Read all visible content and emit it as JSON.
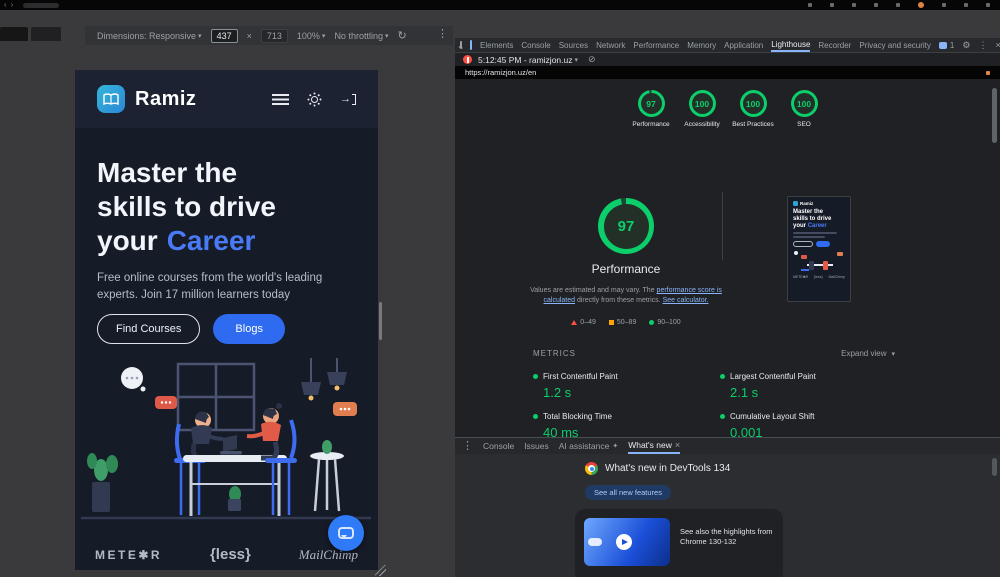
{
  "colors": {
    "accent_blue": "#8ab4f8",
    "green": "#0cce6b",
    "orange": "#ffa400",
    "red": "#ff4e42",
    "site_blue": "#2e6bf0",
    "brand_teal": "#2fa3d8"
  },
  "icons": {
    "back": "‹",
    "forward": "›",
    "caret": "▾",
    "kebab": "⋮",
    "gear": "⚙",
    "close": "×",
    "clear": "⊘",
    "rotate": "↻",
    "spark": "✦",
    "chevron_down": "▾",
    "times": "×",
    "exit_arrow": "→"
  },
  "device_toolbar": {
    "dimensions": "Dimensions: Responsive",
    "width": "437",
    "height": "713",
    "zoom": "100%",
    "throttling": "No throttling"
  },
  "devtools": {
    "tabs": [
      "Elements",
      "Console",
      "Sources",
      "Network",
      "Performance",
      "Memory",
      "Application",
      "Lighthouse",
      "Recorder",
      "Privacy and security"
    ],
    "active_tab": "Lighthouse",
    "badge": "1",
    "run_label": "5:12:45 PM - ramizjon.uz",
    "url": "https://ramizjon.uz/en"
  },
  "lighthouse": {
    "scores": [
      {
        "value": "97",
        "label": "Performance"
      },
      {
        "value": "100",
        "label": "Accessibility"
      },
      {
        "value": "100",
        "label": "Best Practices"
      },
      {
        "value": "100",
        "label": "SEO"
      }
    ],
    "gauge_value": "97",
    "gauge_label": "Performance",
    "disclaimer_pre": "Values are estimated and may vary. The",
    "disclaimer_link1": "performance score is calculated",
    "disclaimer_mid": "directly from these metrics.",
    "disclaimer_link2": "See calculator.",
    "legend": [
      {
        "range": "0–49"
      },
      {
        "range": "50–89"
      },
      {
        "range": "90–100"
      }
    ],
    "metrics_title": "METRICS",
    "expand_view": "Expand view",
    "metrics": [
      {
        "label": "First Contentful Paint",
        "value": "1.2 s"
      },
      {
        "label": "Largest Contentful Paint",
        "value": "2.1 s"
      },
      {
        "label": "Total Blocking Time",
        "value": "40 ms"
      },
      {
        "label": "Cumulative Layout Shift",
        "value": "0.001"
      }
    ]
  },
  "drawer": {
    "tabs": [
      "Console",
      "Issues",
      "AI assistance",
      "What's new"
    ]
  },
  "whats_new": {
    "title": "What's new in DevTools 134",
    "see_all": "See all new features",
    "card_text": "See also the highlights from Chrome 130-132"
  },
  "site": {
    "brand": "Ramiz",
    "heading_line1": "Master the",
    "heading_line2": "skills to drive",
    "heading_line3_pre": "your",
    "heading_accent": "Career",
    "paragraph_line1": "Free online courses from the world's leading",
    "paragraph_line2": "experts. Join 17 million learners today",
    "find_courses": "Find Courses",
    "blogs": "Blogs",
    "logo1": "METE✱R",
    "logo2": "{less}",
    "logo3": "MailChimp"
  }
}
